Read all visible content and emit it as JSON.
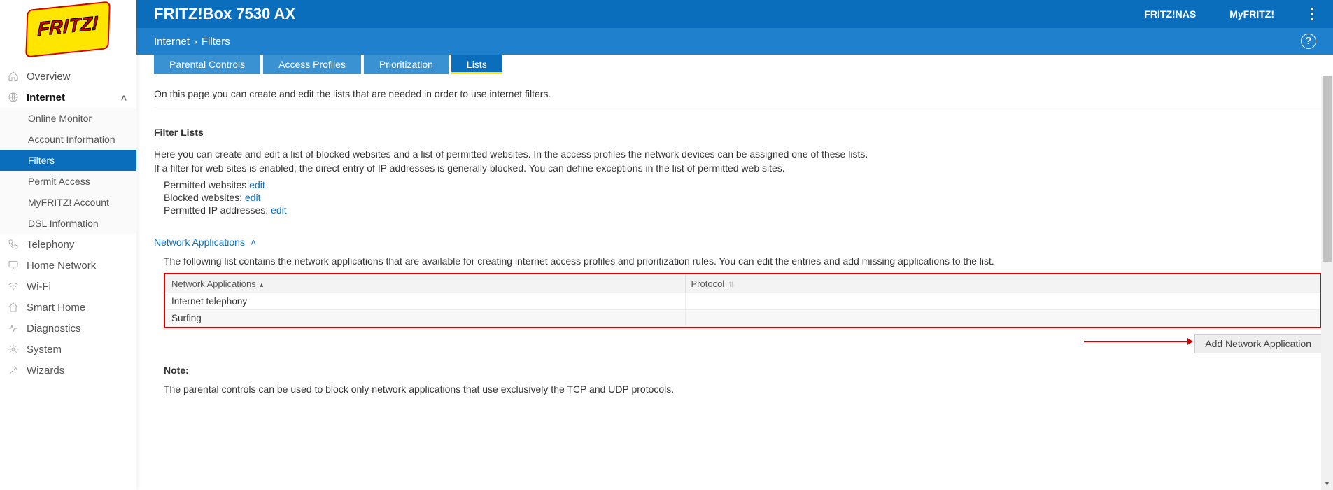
{
  "logo_text": "FRITZ!",
  "header": {
    "title": "FRITZ!Box 7530 AX",
    "links": {
      "fritznas": "FRITZ!NAS",
      "myfritz": "MyFRITZ!"
    }
  },
  "breadcrumb": {
    "root": "Internet",
    "sep": "›",
    "leaf": "Filters"
  },
  "help_icon_glyph": "?",
  "tabs": {
    "parental": "Parental Controls",
    "profiles": "Access Profiles",
    "prio": "Prioritization",
    "lists": "Lists"
  },
  "sidebar": {
    "overview": "Overview",
    "internet": "Internet",
    "internet_sub": {
      "online_monitor": "Online Monitor",
      "account_info": "Account Information",
      "filters": "Filters",
      "permit_access": "Permit Access",
      "myfritz_account": "MyFRITZ! Account",
      "dsl_info": "DSL Information"
    },
    "telephony": "Telephony",
    "home_network": "Home Network",
    "wifi": "Wi-Fi",
    "smart_home": "Smart Home",
    "diagnostics": "Diagnostics",
    "system": "System",
    "wizards": "Wizards"
  },
  "content": {
    "intro": "On this page you can create and edit the lists that are needed in order to use internet filters.",
    "filter_lists_heading": "Filter Lists",
    "filter_lists_p1": "Here you can create and edit a list of blocked websites and a list of permitted websites. In the access profiles the network devices can be assigned one of these lists.",
    "filter_lists_p2": "If a filter for web sites is enabled, the direct entry of IP addresses is generally blocked. You can define exceptions in the list of permitted web sites.",
    "perm_sites_prefix": "Permitted websites ",
    "blocked_sites_prefix": "Blocked websites: ",
    "perm_ip_prefix": "Permitted IP addresses: ",
    "edit_link": "edit",
    "network_apps_heading": "Network Applications",
    "network_apps_desc": "The following list contains the network applications that are available for creating internet access profiles and prioritization rules. You can edit the entries and add missing applications to the list.",
    "table": {
      "col_apps": "Network Applications",
      "col_proto": "Protocol",
      "rows": [
        {
          "app": "Internet telephony",
          "proto": ""
        },
        {
          "app": "Surfing",
          "proto": ""
        }
      ]
    },
    "add_app_btn": "Add Network Application",
    "note_heading": "Note:",
    "note_body": "The parental controls can be used to block only network applications that use exclusively the TCP and UDP protocols."
  }
}
